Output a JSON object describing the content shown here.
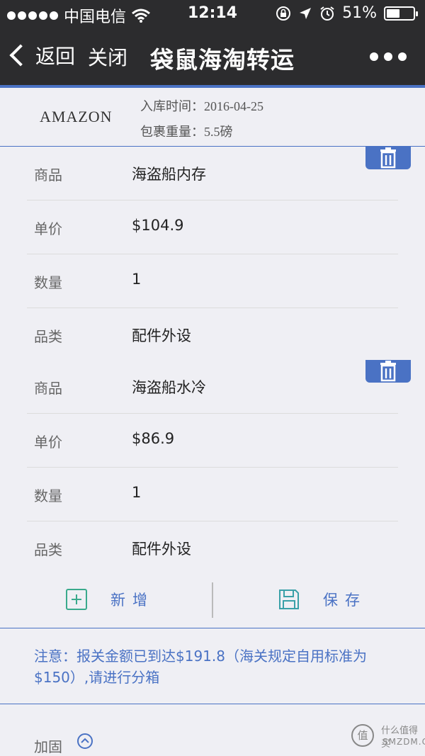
{
  "status_bar": {
    "carrier": "中国电信",
    "time": "12:14",
    "battery": "51%",
    "battery_level": 0.51
  },
  "nav": {
    "back_label": "返回",
    "close_label": "关闭",
    "title": "袋鼠海淘转运"
  },
  "store": {
    "name": "AMAZON",
    "date_text": "入库时间：2016-04-25",
    "weight_text": "包裹重量：5.5磅"
  },
  "items": [
    {
      "product_label": "商品",
      "product": "海盗船内存",
      "price_label": "单价",
      "price": "$104.9",
      "qty_label": "数量",
      "qty": "1",
      "category_label": "品类",
      "category": "配件外设"
    },
    {
      "product_label": "商品",
      "product": "海盗船水冷",
      "price_label": "单价",
      "price": "$86.9",
      "qty_label": "数量",
      "qty": "1",
      "category_label": "品类",
      "category": "配件外设"
    }
  ],
  "actions": {
    "add_label": "新增",
    "save_label": "保存"
  },
  "notice": "注意：报关金额已到达$191.8（海关规定自用标准为$150）,请进行分箱",
  "reinforce": {
    "label": "加固"
  },
  "watermark": {
    "badge": "值",
    "line1": "什么值得买",
    "line2": "SMZDM.COM"
  },
  "colors": {
    "accent": "#4a72c4",
    "add_icon": "#3aaa8c",
    "save_icon": "#3aa0a8",
    "nav_bg": "#2c2c2e"
  }
}
